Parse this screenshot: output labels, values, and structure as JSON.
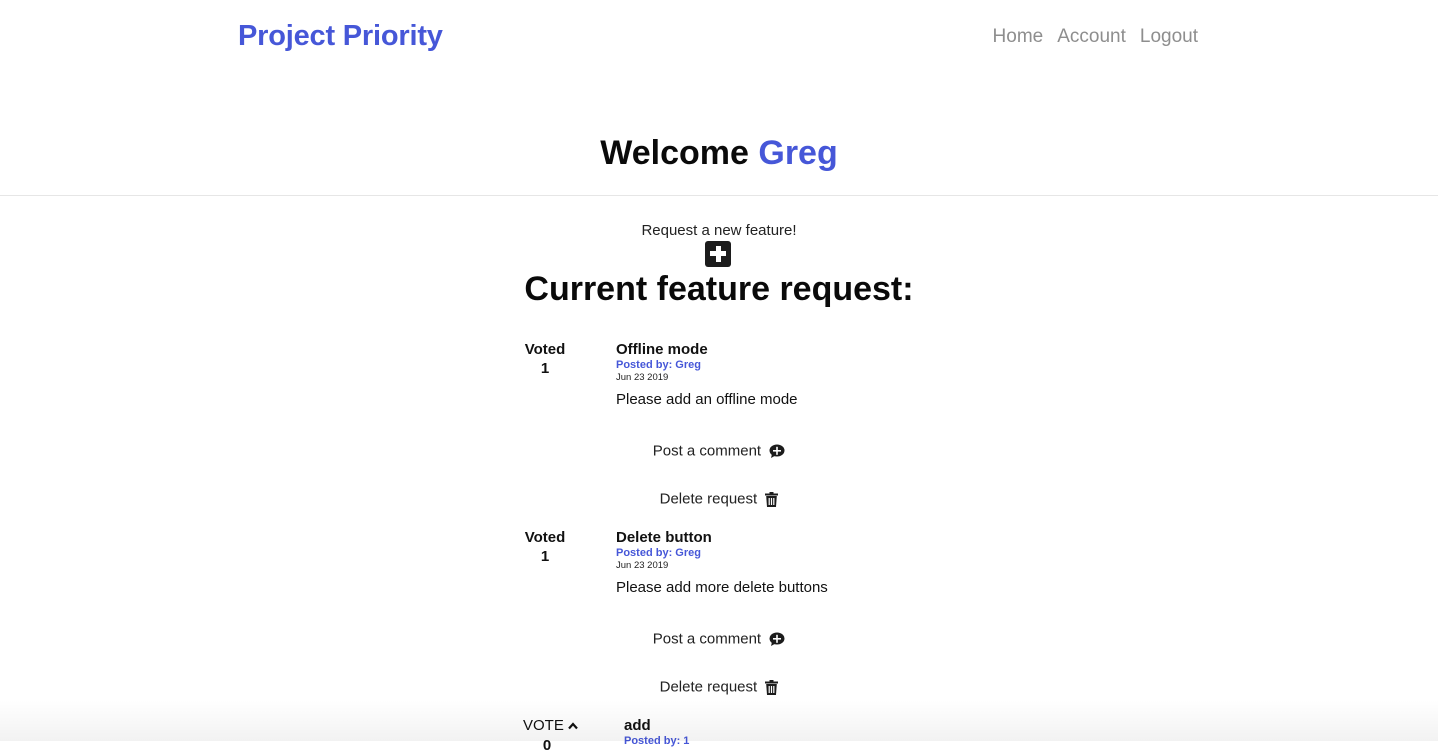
{
  "header": {
    "brand": "Project Priority",
    "nav": [
      "Home",
      "Account",
      "Logout"
    ]
  },
  "welcome": {
    "prefix": "Welcome",
    "username": "Greg"
  },
  "request_new_label": "Request a new feature!",
  "section_title": "Current feature request:",
  "requests": [
    {
      "vote_label": "Voted",
      "vote_count": "1",
      "title": "Offline mode",
      "posted_by": "Posted by: Greg",
      "date": "Jun 23 2019",
      "description": "Please add an offline mode",
      "comment_label": "Post a comment",
      "delete_label": "Delete request"
    },
    {
      "vote_label": "Voted",
      "vote_count": "1",
      "title": "Delete button",
      "posted_by": "Posted by: Greg",
      "date": "Jun 23 2019",
      "description": "Please add more delete buttons",
      "comment_label": "Post a comment",
      "delete_label": "Delete request"
    },
    {
      "vote_label": "VOTE",
      "vote_count": "0",
      "title": "add",
      "posted_by": "Posted by: 1"
    }
  ],
  "icons": {
    "add": "plus-square-icon",
    "comment": "comment-icon",
    "delete": "trash-icon",
    "vote": "chevron-up-icon"
  },
  "colors": {
    "accent": "#4657d8",
    "nav": "#8e8e8e",
    "text": "#111111"
  }
}
